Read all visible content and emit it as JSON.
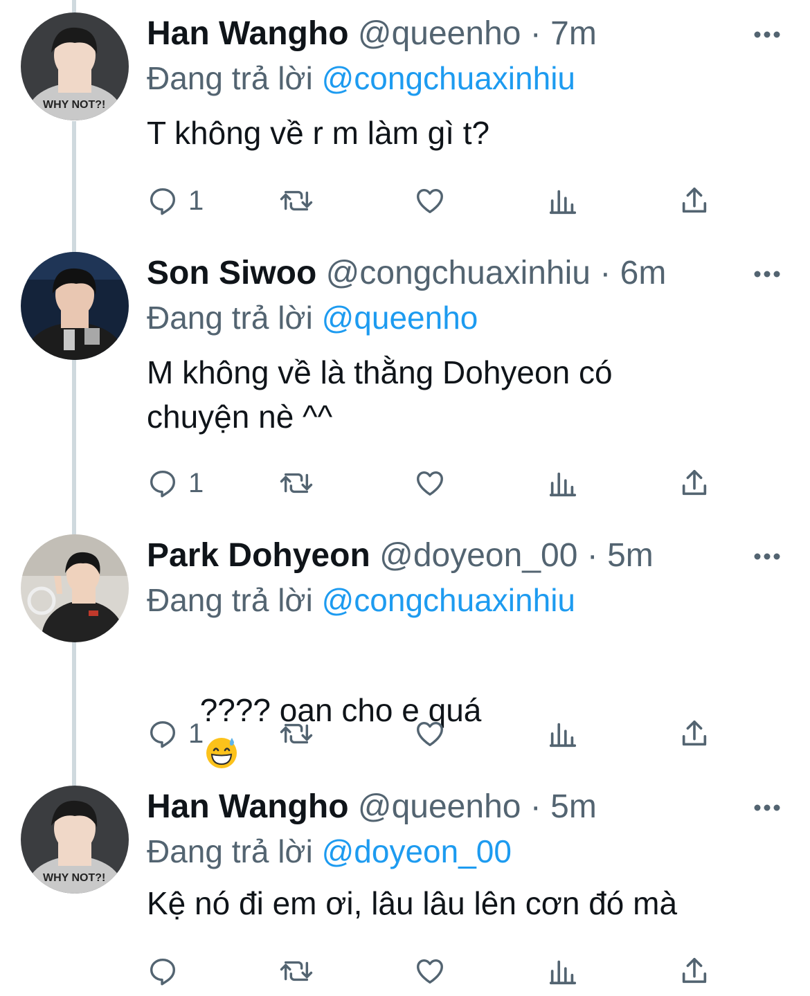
{
  "tweets": [
    {
      "name": "Han Wangho",
      "handle": "@queenho",
      "separator": "·",
      "time": "7m",
      "reply_prefix": "Đang trả lời",
      "reply_to": "@congchuaxinhiu",
      "text": "T không về r m làm gì t?",
      "reply_count": "1",
      "avatar_icon": "avatar-photo",
      "avatar_colors": {
        "bg": "#3b3d40",
        "hoodie": "#c9c9c9",
        "hair": "#1a1a1a",
        "skin": "#f0d8c8"
      }
    },
    {
      "name": "Son Siwoo",
      "handle": "@congchuaxinhiu",
      "separator": "·",
      "time": "6m",
      "reply_prefix": "Đang trả lời",
      "reply_to": "@queenho",
      "text": "M không về là thằng Dohyeon có\nchuyện nè ^^",
      "reply_count": "1",
      "avatar_icon": "avatar-photo",
      "avatar_colors": {
        "bg": "#14233a",
        "hoodie": "#1c1c1c",
        "hair": "#111111",
        "skin": "#e9c7b2"
      }
    },
    {
      "name": "Park Dohyeon",
      "handle": "@doyeon_00",
      "separator": "·",
      "time": "5m",
      "reply_prefix": "Đang trả lời",
      "reply_to": "@congchuaxinhiu",
      "text": "???? oan cho e quá",
      "emoji": "grinning-face-with-sweat",
      "reply_count": "1",
      "avatar_icon": "avatar-photo",
      "avatar_colors": {
        "bg": "#d9d6d0",
        "hoodie": "#222222",
        "hair": "#161616",
        "skin": "#efd2bd"
      }
    },
    {
      "name": "Han Wangho",
      "handle": "@queenho",
      "separator": "·",
      "time": "5m",
      "reply_prefix": "Đang trả lời",
      "reply_to": "@doyeon_00",
      "text": "Kệ nó đi em ơi, lâu lâu lên cơn đó mà",
      "reply_count": "",
      "avatar_icon": "avatar-photo",
      "avatar_colors": {
        "bg": "#3b3d40",
        "hoodie": "#c9c9c9",
        "hair": "#1a1a1a",
        "skin": "#f0d8c8"
      }
    }
  ],
  "icons": {
    "reply": "reply-icon",
    "retweet": "retweet-icon",
    "like": "like-icon",
    "views": "views-icon",
    "share": "share-icon",
    "more": "more-icon"
  },
  "colors": {
    "text_primary": "#0f1419",
    "text_secondary": "#536471",
    "accent": "#1d9bf0",
    "thread_line": "#cfd9de"
  }
}
